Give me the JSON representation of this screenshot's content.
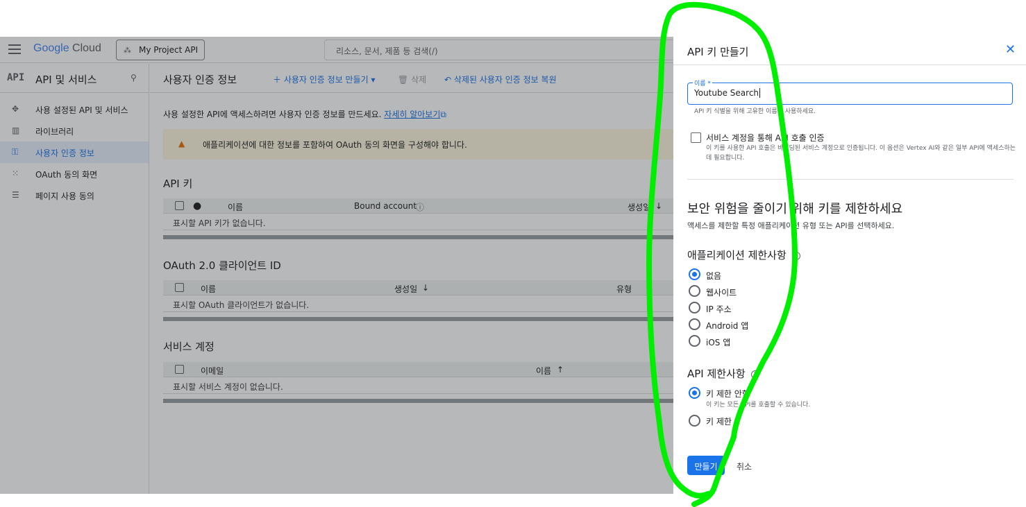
{
  "header": {
    "logo_google": "Google",
    "logo_cloud": "Cloud",
    "project": "My Project API",
    "search_placeholder": "리소스, 문서, 제품 등 검색(/)"
  },
  "sidebar": {
    "api_badge": "API",
    "title": "API 및 서비스",
    "items": [
      {
        "label": "사용 설정된 API 및 서비스",
        "icon": "api-diamond-icon"
      },
      {
        "label": "라이브러리",
        "icon": "library-icon"
      },
      {
        "label": "사용자 인증 정보",
        "icon": "key-icon"
      },
      {
        "label": "OAuth 동의 화면",
        "icon": "oauth-icon"
      },
      {
        "label": "페이지 사용 동의",
        "icon": "settings-list-icon"
      }
    ]
  },
  "main": {
    "title": "사용자 인증 정보",
    "action_create": "사용자 인증 정보 만들기",
    "action_delete": "삭제",
    "action_restore": "삭제된 사용자 인증 정보 복원",
    "intro": "사용 설정한 API에 액세스하려면 사용자 인증 정보를 만드세요.",
    "intro_link": "자세히 알아보기",
    "warning": "애플리케이션에 대한 정보를 포함하여 OAuth 동의 화면을 구성해야 합니다.",
    "api_keys": {
      "title": "API 키",
      "col_name": "이름",
      "col_bound": "Bound account",
      "col_created": "생성일",
      "empty": "표시할 API 키가 없습니다."
    },
    "oauth": {
      "title": "OAuth 2.0 클라이언트 ID",
      "col_name": "이름",
      "col_created": "생성일",
      "col_type": "유형",
      "empty": "표시할 OAuth 클라이언트가 없습니다."
    },
    "service_accounts": {
      "title": "서비스 계정",
      "col_email": "이메일",
      "col_name": "이름",
      "empty": "표시할 서비스 계정이 없습니다."
    }
  },
  "panel": {
    "title": "API 키 만들기",
    "name_label": "이름 *",
    "name_value": "Youtube Search",
    "name_hint": "API 키 식별을 위해 고유한 이름을 사용하세요.",
    "sa_checkbox_label": "서비스 계정을 통해 API 호출 인증",
    "sa_checkbox_desc": "이 키를 사용한 API 호출은 바인딩된 서비스 계정으로 인증됩니다. 이 옵션은 Vertex AI와 같은 일부 API에 액세스하는 데 필요합니다.",
    "restrict_title": "보안 위험을 줄이기 위해 키를 제한하세요",
    "restrict_sub": "액세스를 제한할 특정 애플리케이션 유형 또는 API를 선택하세요.",
    "app_restrict_title": "애플리케이션 제한사항",
    "app_options": [
      "없음",
      "웹사이트",
      "IP 주소",
      "Android 앱",
      "iOS 앱"
    ],
    "app_selected": "없음",
    "api_restrict_title": "API 제한사항",
    "api_options": [
      "키 제한 안함",
      "키 제한"
    ],
    "api_selected": "키 제한 안함",
    "api_no_restrict_desc": "이 키는 모든 API를 호출할 수 있습니다.",
    "create_button": "만들기",
    "cancel_button": "취소"
  },
  "annotation": {
    "color": "#00ee00"
  }
}
